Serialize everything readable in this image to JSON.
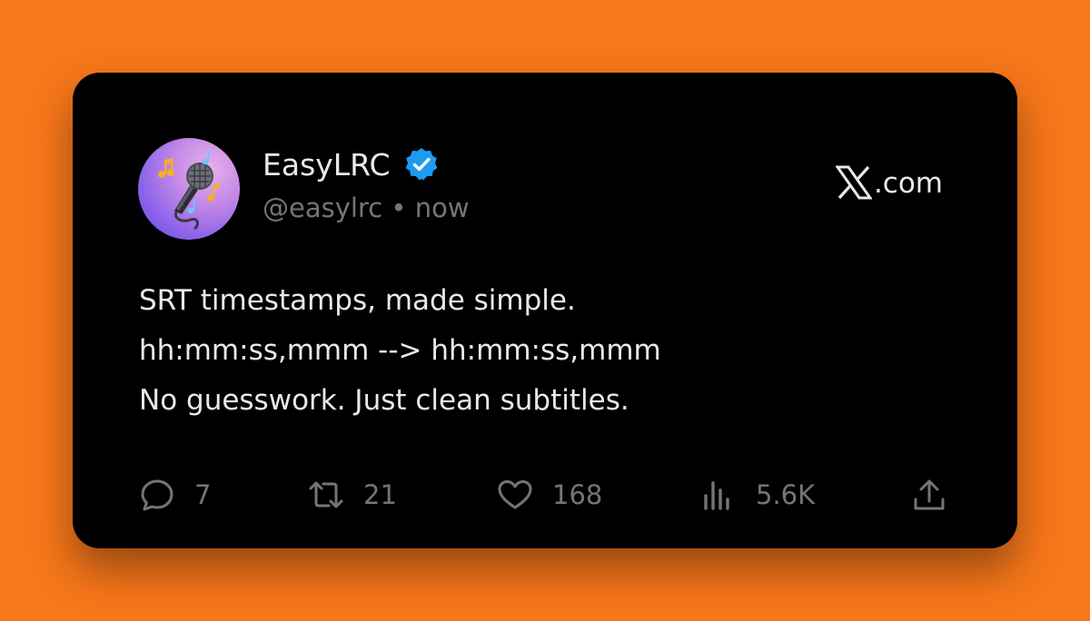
{
  "author": {
    "name": "EasyLRC",
    "handle": "@easylrc",
    "separator": "•",
    "time": "now",
    "avatar": "microphone-with-music-notes-avatar",
    "verified": true
  },
  "brand": {
    "icon": "x-logo",
    "domain_suffix": ".com"
  },
  "post": {
    "lines": [
      "SRT timestamps, made simple.",
      "hh:mm:ss,mmm --> hh:mm:ss,mmm",
      "No guesswork. Just clean subtitles."
    ]
  },
  "actions": {
    "reply": {
      "icon": "reply-icon",
      "count": "7"
    },
    "repost": {
      "icon": "repost-icon",
      "count": "21"
    },
    "like": {
      "icon": "heart-icon",
      "count": "168"
    },
    "views": {
      "icon": "views-icon",
      "count": "5.6K"
    },
    "share": {
      "icon": "share-icon"
    }
  },
  "colors": {
    "background": "#f7771a",
    "card": "#000000",
    "primary_text": "#e7e9ea",
    "secondary_text": "#71767b",
    "verified_badge": "#1d9bf0"
  }
}
